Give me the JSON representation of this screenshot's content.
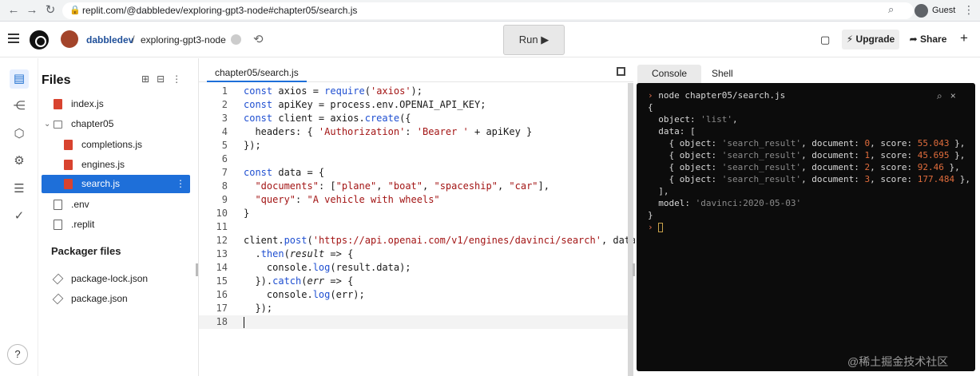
{
  "browser": {
    "url": "replit.com/@dabbledev/exploring-gpt3-node#chapter05/search.js",
    "profile_label": "Guest"
  },
  "header": {
    "owner": "dabbledev",
    "separator": "/",
    "repl_name": "exploring-gpt3-node",
    "run_label": "Run ▶",
    "upgrade_label": "Upgrade",
    "share_label": "Share"
  },
  "files": {
    "title": "Files",
    "items": [
      {
        "name": "index.js",
        "type": "js"
      },
      {
        "name": "chapter05",
        "type": "folder"
      },
      {
        "name": "completions.js",
        "type": "js"
      },
      {
        "name": "engines.js",
        "type": "js"
      },
      {
        "name": "search.js",
        "type": "js"
      },
      {
        "name": ".env",
        "type": "doc"
      },
      {
        "name": ".replit",
        "type": "doc"
      }
    ],
    "packager_title": "Packager files",
    "packager_items": [
      "package-lock.json",
      "package.json"
    ]
  },
  "editor": {
    "tab_label": "chapter05/search.js",
    "line_numbers": [
      "1",
      "2",
      "3",
      "4",
      "5",
      "6",
      "7",
      "8",
      "9",
      "10",
      "11",
      "12",
      "13",
      "14",
      "15",
      "16",
      "17",
      "18"
    ]
  },
  "console": {
    "tabs": [
      "Console",
      "Shell"
    ],
    "command": "node chapter05/search.js",
    "results": [
      {
        "document": "0",
        "score": "55.043"
      },
      {
        "document": "1",
        "score": "45.695"
      },
      {
        "document": "2",
        "score": "92.46"
      },
      {
        "document": "3",
        "score": "177.484"
      }
    ],
    "object_value": "'list'",
    "result_object": "'search_result'",
    "model": "'davinci:2020-05-03'"
  },
  "watermark": "@稀土掘金技术社区",
  "colors": {
    "accent": "#1e6fd9",
    "js_icon": "#d8432f",
    "console_bg": "#0c0c0c"
  }
}
